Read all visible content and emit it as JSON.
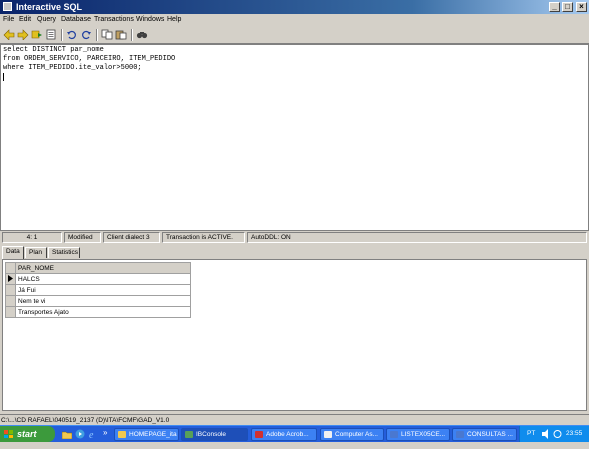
{
  "window": {
    "title": "Interactive SQL",
    "minimize": "_",
    "maximize": "□",
    "close": "×"
  },
  "menu": [
    "File",
    "Edit",
    "Query",
    "Database",
    "Transactions",
    "Windows",
    "Help"
  ],
  "toolbar": {
    "icons": [
      "prev-query-icon",
      "next-query-icon",
      "execute-query-icon",
      "query-history-icon",
      "commit-icon",
      "rollback-icon",
      "copy-icon",
      "paste-icon",
      "find-icon"
    ]
  },
  "editor": {
    "lines": [
      "select DISTINCT par_nome",
      "from ORDEM_SERVICO, PARCEIRO, ITEM_PEDIDO",
      "where ITEM_PEDIDO.ite_valor>5000;"
    ]
  },
  "status": {
    "cursor": "4:  1",
    "modified": "Modified",
    "dialect": "Client dialect 3",
    "transaction": "Transaction is ACTIVE.",
    "autoddl": "AutoDDL: ON"
  },
  "tabs": [
    "Data",
    "Plan",
    "Statistics"
  ],
  "results": {
    "columns": [
      "PAR_NOME"
    ],
    "rows": [
      "HALCS",
      "Já Fui",
      "Nem te vi",
      "Transportes Ajato"
    ]
  },
  "path_bar": "C:\\...\\CD RAFAEL\\040519_2137 (D)\\ITA\\FCMF\\GAD_V1.0",
  "taskbar": {
    "start_label": "start",
    "overflow": "»",
    "tasks": [
      {
        "label": "HOMEPAGE_ita",
        "icon_color": "#f0c850"
      },
      {
        "label": "IBConsole",
        "icon_color": "#58a058"
      },
      {
        "label": "Adobe Acrob...",
        "icon_color": "#d03030"
      },
      {
        "label": "Computer As...",
        "icon_color": "#f0f0f0"
      },
      {
        "label": "LISTEX05CE...",
        "icon_color": "#4a78d0"
      },
      {
        "label": "CONSULTAS ...",
        "icon_color": "#4a78d0"
      }
    ],
    "tray": {
      "language": "PT",
      "clock": "23:55"
    }
  },
  "colors": {
    "title_bar": "#0a246a",
    "taskbar": "#245edb",
    "start_button": "#3c9a3c",
    "tray": "#0f8ced"
  }
}
